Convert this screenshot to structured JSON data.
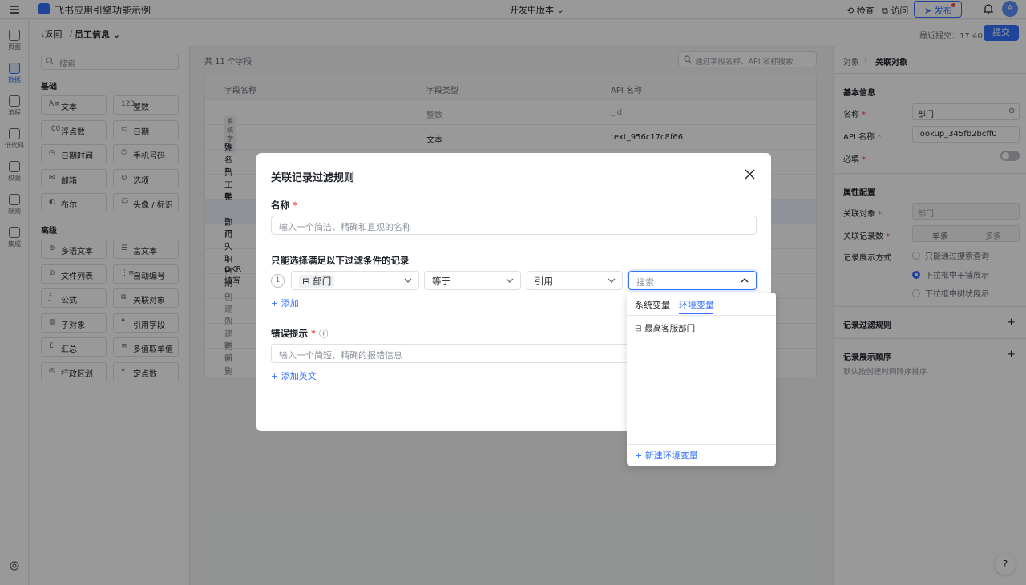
{
  "app": {
    "title": "飞书应用引擎功能示例",
    "version": "开发中版本",
    "check": "检查",
    "visit": "访问",
    "publish": "发布",
    "avatar": "A"
  },
  "nav": [
    {
      "label": "页面",
      "icon": "page-icon"
    },
    {
      "label": "数据",
      "icon": "database-icon",
      "active": true
    },
    {
      "label": "流程",
      "icon": "flow-icon"
    },
    {
      "label": "低代码",
      "icon": "code-icon"
    },
    {
      "label": "权限",
      "icon": "lock-icon"
    },
    {
      "label": "规则",
      "icon": "rule-icon"
    },
    {
      "label": "集成",
      "icon": "integration-icon"
    }
  ],
  "subheader": {
    "back": "返回",
    "object": "员工信息",
    "last_commit": "最近提交：17:40",
    "submit": "提交"
  },
  "palette": {
    "search_placeholder": "搜索",
    "basic_title": "基础",
    "basic": [
      {
        "g": "A≡",
        "label": "文本"
      },
      {
        "g": "123",
        "label": "整数"
      },
      {
        "g": ".00",
        "label": "浮点数"
      },
      {
        "g": "▭",
        "label": "日期"
      },
      {
        "g": "◷",
        "label": "日期时间"
      },
      {
        "g": "✆",
        "label": "手机号码"
      },
      {
        "g": "✉",
        "label": "邮箱"
      },
      {
        "g": "⊙",
        "label": "选项"
      },
      {
        "g": "◐",
        "label": "布尔"
      },
      {
        "g": "☺",
        "label": "头像 / 标识"
      }
    ],
    "advanced_title": "高级",
    "advanced": [
      {
        "g": "⊕",
        "label": "多语文本"
      },
      {
        "g": "☰",
        "label": "富文本"
      },
      {
        "g": "⊘",
        "label": "文件列表"
      },
      {
        "g": "⋮≡",
        "label": "自动编号"
      },
      {
        "g": "ƒ",
        "label": "公式"
      },
      {
        "g": "⧉",
        "label": "关联对象"
      },
      {
        "g": "▤",
        "label": "子对象"
      },
      {
        "g": "❝",
        "label": "引用字段"
      },
      {
        "g": "Σ",
        "label": "汇总"
      },
      {
        "g": "≡",
        "label": "多值取单值"
      },
      {
        "g": "◎",
        "label": "行政区划"
      },
      {
        "g": "⌖",
        "label": "定点数"
      }
    ]
  },
  "fields": {
    "count": "共 11 个字段",
    "search_placeholder": "通过字段名称、API 名称搜索",
    "headers": [
      "字段名称",
      "字段类型",
      "API 名称"
    ],
    "rows": [
      {
        "name": "ID",
        "badge": "系统字段",
        "type": "整数",
        "api": "_id",
        "muted": true
      },
      {
        "name": "姓名",
        "type": "文本",
        "api": "text_956c17c8f66"
      },
      {
        "name": "员工类型",
        "type": "",
        "api": ""
      },
      {
        "name": "是否转正",
        "type": "",
        "api": ""
      },
      {
        "name": "部门",
        "type": "",
        "api": "",
        "selected": true
      },
      {
        "name": "入职日期",
        "type": "",
        "api": ""
      },
      {
        "name": "OKR填写",
        "type": "",
        "api": ""
      },
      {
        "name": "创建人",
        "type": "",
        "api": "",
        "muted": true
      },
      {
        "name": "创建时间",
        "type": "",
        "api": "",
        "muted": true
      },
      {
        "name": "更新人",
        "type": "",
        "api": "",
        "muted": true
      },
      {
        "name": "更新时间",
        "type": "",
        "api": "",
        "muted": true
      }
    ]
  },
  "props": {
    "crumb_root": "对象",
    "crumb_current": "关联对象",
    "basic_title": "基本信息",
    "name_label": "名称",
    "name_value": "部门",
    "api_label": "API 名称",
    "api_value": "lookup_345fb2bcff0",
    "required_label": "必填",
    "config_title": "属性配置",
    "rel_object_label": "关联对象",
    "rel_object_value": "部门",
    "rel_count_label": "关联记录数",
    "rel_count_single": "单条",
    "rel_count_multi": "多条",
    "display_label": "记录展示方式",
    "display_options": [
      "只能通过搜索查询",
      "下拉框中平铺展示",
      "下拉框中树状展示"
    ],
    "filter_rule_title": "记录过滤规则",
    "order_title": "记录展示顺序",
    "order_desc": "默认按创建时间降序排序"
  },
  "modal": {
    "title": "关联记录过滤规则",
    "name_label": "名称",
    "name_placeholder": "输入一个简洁、精确和直观的名称",
    "cond_title": "只能选择满足以下过滤条件的记录",
    "cond_index": "1",
    "cond_field": "部门",
    "cond_op": "等于",
    "cond_type": "引用",
    "add": "添加",
    "err_label": "错误提示",
    "err_placeholder": "输入一个简短、精确的报错信息",
    "add_en": "添加英文"
  },
  "dropdown": {
    "search_placeholder": "搜索",
    "tabs": [
      "系统变量",
      "环境变量"
    ],
    "active_tab": "环境变量",
    "items": [
      "最高客服部门"
    ],
    "new_var": "新建环境变量"
  }
}
